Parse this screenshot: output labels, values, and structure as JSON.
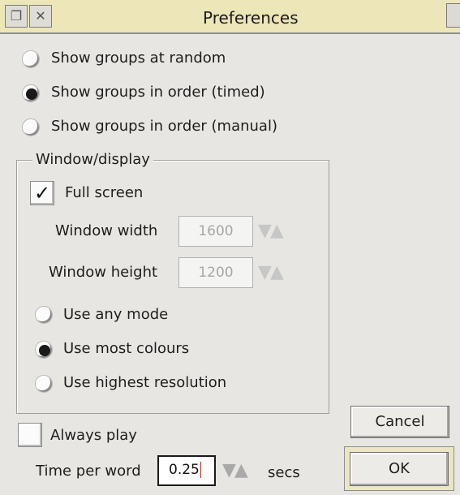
{
  "window": {
    "title": "Preferences"
  },
  "titlebar": {
    "back_icon": "back-icon",
    "close_icon": "close-icon"
  },
  "options": [
    {
      "label": "Show groups at random",
      "selected": false
    },
    {
      "label": "Show groups in order (timed)",
      "selected": true
    },
    {
      "label": "Show groups in order (manual)",
      "selected": false
    }
  ],
  "display": {
    "group_label": "Window/display",
    "full_screen_label": "Full screen",
    "full_screen_checked": true,
    "width_label": "Window width",
    "width_value": "1600",
    "height_label": "Window height",
    "height_value": "1200",
    "modes": [
      {
        "label": "Use any mode",
        "selected": false
      },
      {
        "label": "Use most colours",
        "selected": true
      },
      {
        "label": "Use highest resolution",
        "selected": false
      }
    ]
  },
  "always_play": {
    "label": "Always play",
    "checked": false
  },
  "time_per_word": {
    "label": "Time per word",
    "value": "0.25",
    "unit": "secs"
  },
  "buttons": {
    "cancel": "Cancel",
    "ok": "OK"
  },
  "arrow_glyphs": "▼▲",
  "colors": {
    "titlebar": "#ece6b8",
    "ok_frame": "#eae6c4"
  }
}
